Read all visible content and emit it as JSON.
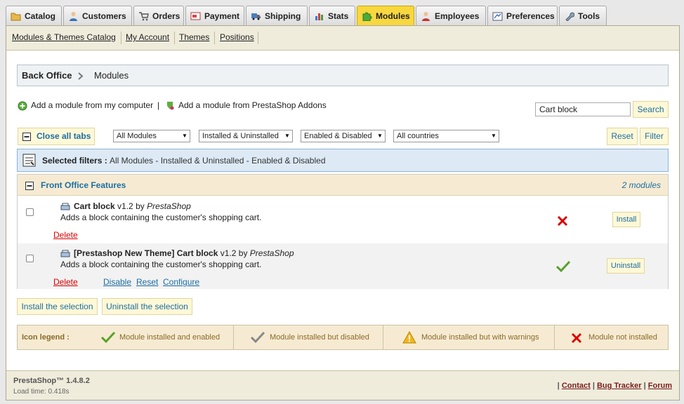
{
  "tabs": [
    {
      "label": "Catalog",
      "icon": "folder-icon"
    },
    {
      "label": "Customers",
      "icon": "customer-icon"
    },
    {
      "label": "Orders",
      "icon": "cart-icon"
    },
    {
      "label": "Payment",
      "icon": "payment-icon"
    },
    {
      "label": "Shipping",
      "icon": "truck-icon"
    },
    {
      "label": "Stats",
      "icon": "stats-icon"
    },
    {
      "label": "Modules",
      "icon": "puzzle-icon",
      "active": true
    },
    {
      "label": "Employees",
      "icon": "employee-icon"
    },
    {
      "label": "Preferences",
      "icon": "preferences-icon"
    },
    {
      "label": "Tools",
      "icon": "wrench-icon"
    }
  ],
  "subnav": [
    "Modules & Themes Catalog",
    "My Account",
    "Themes",
    "Positions"
  ],
  "breadcrumb": {
    "root": "Back Office",
    "current": "Modules"
  },
  "add_links": {
    "computer": "Add a module from my computer",
    "separator": "|",
    "addons": "Add a module from PrestaShop Addons"
  },
  "search": {
    "value": "Cart block",
    "button": "Search"
  },
  "filters": {
    "close_tabs": "Close all tabs",
    "modules": "All Modules",
    "installed": "Installed & Uninstalled",
    "enabled": "Enabled & Disabled",
    "countries": "All countries",
    "reset": "Reset",
    "filter": "Filter"
  },
  "selected_filters": {
    "label": "Selected filters :",
    "value": "All Modules - Installed & Uninstalled - Enabled & Disabled"
  },
  "section": {
    "title": "Front Office Features",
    "count": "2 modules"
  },
  "modules": [
    {
      "name": "Cart block",
      "version": "v1.2",
      "by": "by",
      "author": "PrestaShop",
      "description": "Adds a block containing the customer's shopping cart.",
      "status": "not-installed",
      "action": "Install",
      "links": [
        "Delete"
      ]
    },
    {
      "name": "[Prestashop New Theme] Cart block",
      "version": "v1.2",
      "by": "by",
      "author": "PrestaShop",
      "description": "Adds a block containing the customer's shopping cart.",
      "status": "installed-enabled",
      "action": "Uninstall",
      "links": [
        "Delete",
        "Disable",
        "Reset",
        "Configure"
      ]
    }
  ],
  "bulk": {
    "install": "Install the selection",
    "uninstall": "Uninstall the selection"
  },
  "legend": {
    "label": "Icon legend :",
    "items": [
      "Module installed and enabled",
      "Module installed but disabled",
      "Module installed but with warnings",
      "Module not installed"
    ]
  },
  "footer": {
    "version": "PrestaShop™ 1.4.8.2",
    "load_time": "Load time: 0.418s",
    "links": [
      "Contact",
      "Bug Tracker",
      "Forum"
    ]
  },
  "colors": {
    "active_tab": "#f8d73f",
    "link": "#1c6ea4",
    "delete": "#dd0000",
    "ok": "#3a9a1a",
    "error": "#d00000"
  }
}
